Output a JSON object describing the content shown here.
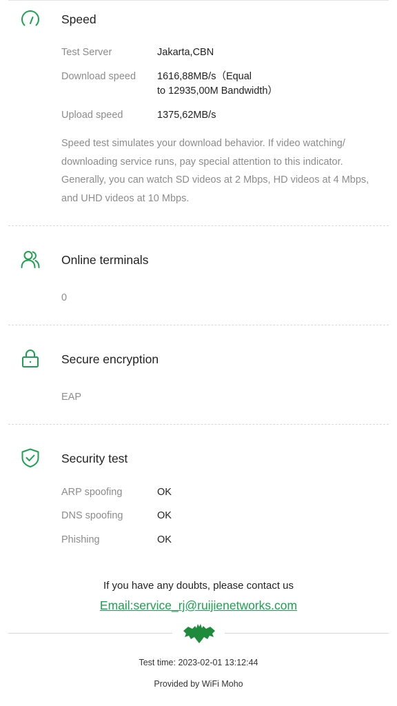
{
  "speed": {
    "icon": "speedometer-icon",
    "title": "Speed",
    "rows": [
      {
        "label": "Test Server",
        "value": "Jakarta,CBN"
      },
      {
        "label": "Download speed",
        "value_line1": "1616,88MB/s（Equal",
        "value_line2": "to 12935,00M Bandwidth）"
      },
      {
        "label": "Upload speed",
        "value": "1375,62MB/s"
      }
    ],
    "description": "Speed test simulates your download behavior. If video watching/ downloading service runs, pay special attention to this indicator. Generally, you can watch SD videos at 2 Mbps, HD videos at 4 Mbps, and UHD videos at 10 Mbps."
  },
  "online_terminals": {
    "icon": "users-icon",
    "title": "Online terminals",
    "value": "0"
  },
  "secure_encryption": {
    "icon": "lock-icon",
    "title": "Secure encryption",
    "value": "EAP"
  },
  "security_test": {
    "icon": "shield-check-icon",
    "title": "Security test",
    "rows": [
      {
        "label": "ARP spoofing",
        "value": "OK"
      },
      {
        "label": "DNS spoofing",
        "value": "OK"
      },
      {
        "label": "Phishing",
        "value": "OK"
      }
    ]
  },
  "footer": {
    "contact_text": "If you have any doubts, please contact us",
    "email_link": "Email:service_rj@ruijienetworks.com",
    "logo_icon": "bat-logo-icon",
    "test_time": "Test time: 2023-02-01 13:12:44",
    "provided_by": "Provided by WiFi Moho"
  },
  "colors": {
    "accent": "#1aa24f",
    "label": "#8c8c8c",
    "text": "#222222",
    "logo": "#1e8a3c"
  }
}
